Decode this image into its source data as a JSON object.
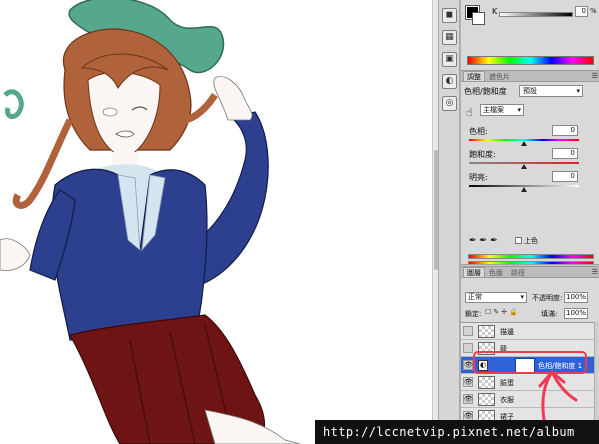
{
  "color_panel": {
    "k_label": "K",
    "k_value": "0",
    "k_unit": "%"
  },
  "adjustments_panel": {
    "tabs": [
      "調整",
      "遮色片"
    ],
    "title": "色相/飽和度",
    "preset_value": "預設",
    "channel_value": "主檔案",
    "hue_label": "色相:",
    "hue_value": "0",
    "saturation_label": "飽和度:",
    "saturation_value": "0",
    "lightness_label": "明亮:",
    "lightness_value": "0",
    "colorize_label": "上色"
  },
  "layers_panel": {
    "tabs": [
      "圖層",
      "色版",
      "路徑"
    ],
    "blend_mode": "正常",
    "opacity_label": "不透明度:",
    "opacity_value": "100%",
    "lock_label": "鎖定:",
    "fill_label": "填滿:",
    "fill_value": "100%",
    "layers": [
      {
        "name": "描邊",
        "visible": false,
        "selected": false
      },
      {
        "name": "龍",
        "visible": false,
        "selected": false
      },
      {
        "name": "色相/飽和度 1",
        "visible": true,
        "selected": true
      },
      {
        "name": "臉蛋",
        "visible": true,
        "selected": false
      },
      {
        "name": "衣服",
        "visible": true,
        "selected": false
      },
      {
        "name": "裙子",
        "visible": true,
        "selected": false
      }
    ]
  },
  "watermark": {
    "url": "http://lccnetvip.pixnet.net/album"
  },
  "colors": {
    "selection_blue": "#2f62d6",
    "annotation_red": "#f03a54",
    "jacket_blue": "#2d3f8f",
    "skirt_red": "#6e1414",
    "hair_brown": "#b0623a",
    "dragon_green": "#56a88c"
  }
}
